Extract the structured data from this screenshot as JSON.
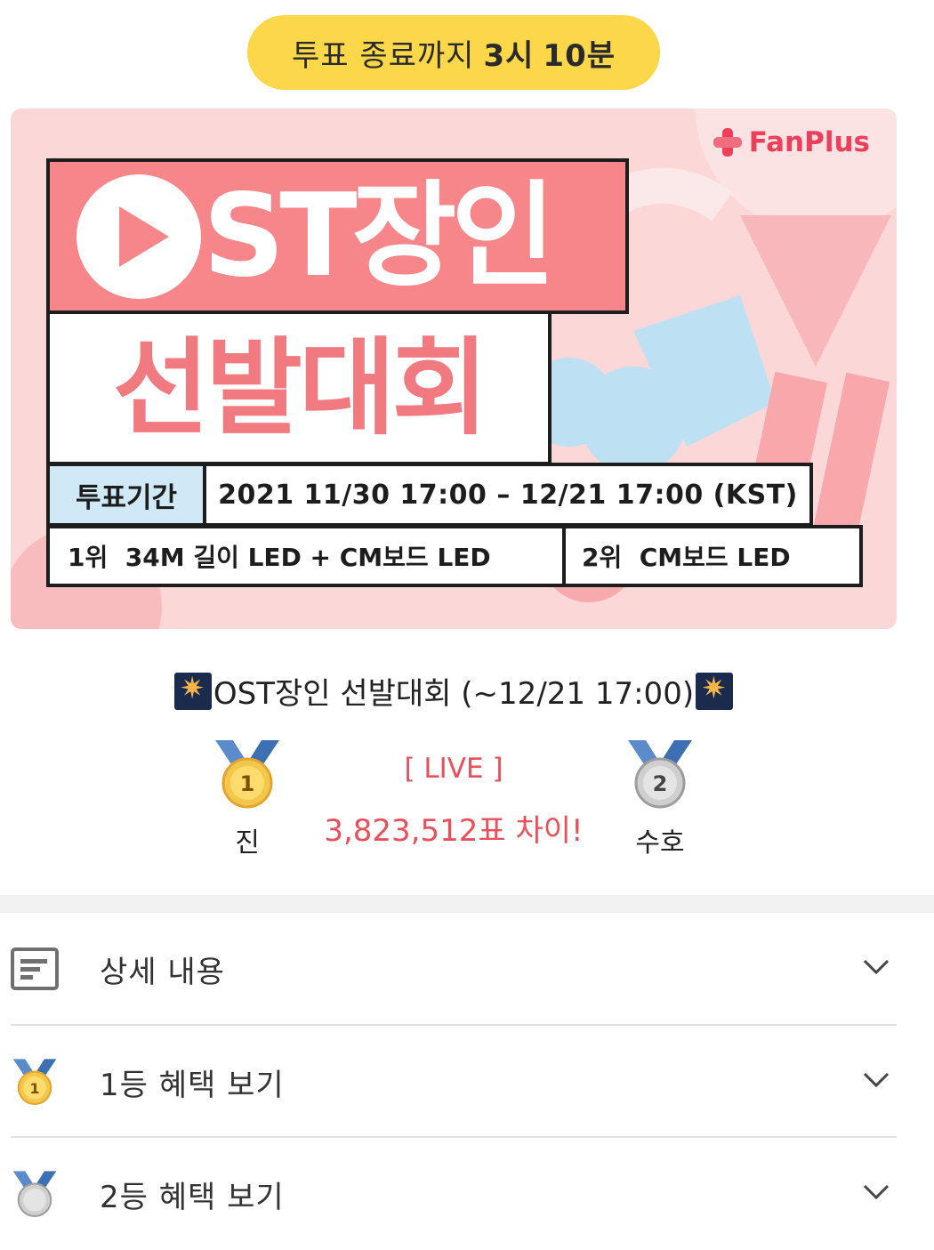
{
  "timer": {
    "prefix": "투표 종료까지",
    "hours": "3시",
    "minutes": "10분"
  },
  "banner": {
    "brand": "FanPlus",
    "title": "ST장인",
    "subtitle": "선발대회",
    "period_label": "투표기간",
    "period_value": "2021 11/30 17:00 – 12/21 17:00 (KST)",
    "prize1_rank": "1위",
    "prize1_text": "34M 길이 LED + CM보드 LED",
    "prize2_rank": "2위",
    "prize2_text": "CM보드 LED",
    "colors": {
      "background": "#fcd7d8",
      "title_box": "#f7868b",
      "label_box": "#cfeaf6"
    }
  },
  "vote": {
    "title": "OST장인 선발대회 (~12/21 17:00)",
    "live_label": "[ LIVE ]",
    "difference": "3,823,512표 차이!",
    "first": {
      "medal_number": "1",
      "name": "진"
    },
    "second": {
      "medal_number": "2",
      "name": "수호"
    }
  },
  "accordion": [
    {
      "label": "상세 내용",
      "icon": "document-icon"
    },
    {
      "label": "1등 혜택 보기",
      "icon": "gold-medal-icon"
    },
    {
      "label": "2등 혜택 보기",
      "icon": "silver-medal-icon"
    }
  ]
}
